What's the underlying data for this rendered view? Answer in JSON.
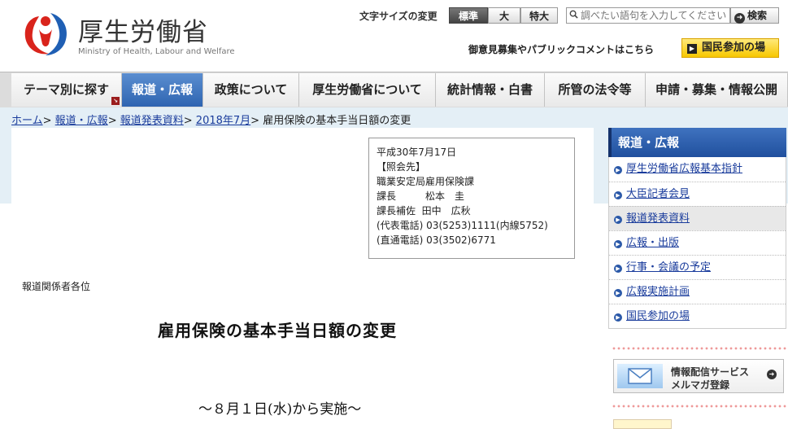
{
  "header": {
    "logo_title": "厚生労働省",
    "logo_subtitle": "Ministry of Health, Labour and Welfare",
    "font_size_label": "文字サイズの変更",
    "font_sizes": [
      {
        "label": "標準",
        "active": true
      },
      {
        "label": "大",
        "active": false
      },
      {
        "label": "特大",
        "active": false
      }
    ],
    "search_placeholder": "調べたい語句を入力してください",
    "search_button": "検索",
    "opinion_text": "御意見募集やパブリックコメントはこちら",
    "participation_button": "国民参加の場"
  },
  "global_nav": [
    {
      "label": "テーマ別に探す",
      "active": false
    },
    {
      "label": "報道・広報",
      "active": true
    },
    {
      "label": "政策について",
      "active": false
    },
    {
      "label": "厚生労働省について",
      "active": false
    },
    {
      "label": "統計情報・白書",
      "active": false
    },
    {
      "label": "所管の法令等",
      "active": false
    },
    {
      "label": "申請・募集・情報公開",
      "active": false
    }
  ],
  "breadcrumb": {
    "links": [
      "ホーム",
      "報道・広報",
      "報道発表資料",
      "2018年7月"
    ],
    "current": "雇用保険の基本手当日額の変更"
  },
  "contact": {
    "lines": [
      "平成30年7月17日",
      "【照会先】",
      "職業安定局雇用保険課",
      "課長　　　松本　圭",
      "課長補佐  田中　広秋",
      "(代表電話) 03(5253)1111(内線5752)",
      "(直通電話) 03(3502)6771"
    ]
  },
  "document": {
    "recipients": "報道関係者各位",
    "title": "雇用保険の基本手当日額の変更",
    "subtitle": "～８月１日(水)から実施～"
  },
  "sidebar": {
    "heading": "報道・広報",
    "items": [
      {
        "label": "厚生労働省広報基本指針",
        "active": false
      },
      {
        "label": "大臣記者会見",
        "active": false
      },
      {
        "label": "報道発表資料",
        "active": true
      },
      {
        "label": "広報・出版",
        "active": false
      },
      {
        "label": "行事・会議の予定",
        "active": false
      },
      {
        "label": "広報実施計画",
        "active": false
      },
      {
        "label": "国民参加の場",
        "active": false
      }
    ],
    "mail_banner": {
      "line1": "情報配信サービス",
      "line2": "メルマガ登録"
    }
  },
  "colors": {
    "accent": "#2e64b1",
    "band": "#e4eff6",
    "link": "#1a3c9c",
    "logo_red": "#d9241c",
    "logo_blue": "#1f5fb4"
  }
}
